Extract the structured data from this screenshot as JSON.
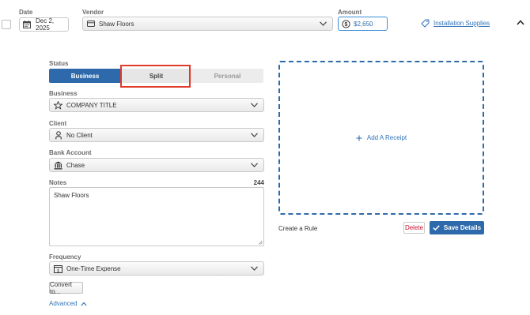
{
  "header": {
    "date_label": "Date",
    "date_value": "Dec 2, 2025",
    "vendor_label": "Vendor",
    "vendor_value": "Shaw Floors",
    "amount_label": "Amount",
    "amount_value": "$2,650",
    "category_link": "Installation Supplies"
  },
  "status": {
    "label": "Status",
    "options": [
      "Business",
      "Split",
      "Personal"
    ],
    "selected": "Business",
    "highlighted": "Split",
    "highlight_color": "#e03a2a",
    "accent_color": "#2e6aab"
  },
  "business": {
    "label": "Business",
    "value": "COMPANY TITLE"
  },
  "client": {
    "label": "Client",
    "value": "No Client"
  },
  "bank_account": {
    "label": "Bank Account",
    "value": "Chase"
  },
  "notes": {
    "label": "Notes",
    "count": "244",
    "value": "Shaw Floors"
  },
  "frequency": {
    "label": "Frequency",
    "value": "One-Time Expense"
  },
  "convert_button": "Convert to...",
  "advanced_link": "Advanced",
  "receipt": {
    "add_label": "Add A Receipt"
  },
  "actions": {
    "create_rule": "Create a Rule",
    "delete": "Delete",
    "save": "Save Details"
  }
}
